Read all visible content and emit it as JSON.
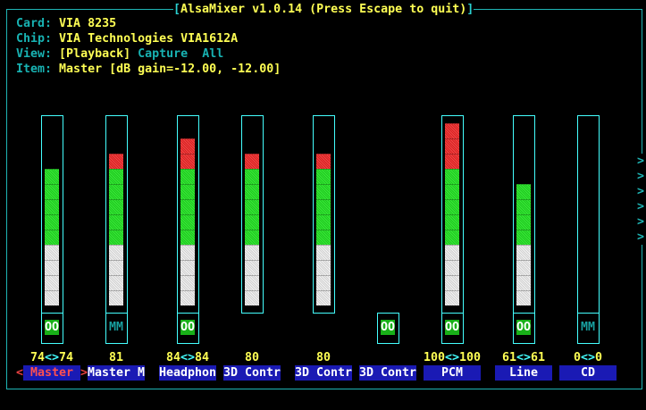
{
  "title": "AlsaMixer v1.0.14 (Press Escape to quit)",
  "info": {
    "card_label": "Card:",
    "card": "VIA 8235",
    "chip_label": "Chip:",
    "chip": "VIA Technologies VIA1612A",
    "view_label": "View:",
    "view_playback": "[Playback]",
    "view_capture": "Capture",
    "view_all": "All",
    "item_label": "Item:",
    "item": "Master [dB gain=-12.00, -12.00]"
  },
  "selected_left": "<",
  "selected_right": ">",
  "more_arrow": ">",
  "channels": [
    {
      "name": "Master",
      "volume": "74",
      "volume_r": "74",
      "stereo": true,
      "level": 74,
      "green": 5,
      "red": 0,
      "switch": "OO",
      "switch_on": true,
      "bar": true
    },
    {
      "name": "Master M",
      "volume": "81",
      "stereo": false,
      "level": 81,
      "green": 5,
      "red": 1,
      "switch": "MM",
      "switch_on": false,
      "bar": true
    },
    {
      "name": "Headphon",
      "volume": "84",
      "volume_r": "84",
      "stereo": true,
      "level": 84,
      "green": 5,
      "red": 2,
      "switch": "OO",
      "switch_on": true,
      "bar": true
    },
    {
      "name": "3D Contr",
      "volume": "80",
      "stereo": false,
      "level": 80,
      "green": 5,
      "red": 1,
      "switch": null,
      "bar": true
    },
    {
      "name": "3D Contr",
      "volume": "80",
      "stereo": false,
      "level": 80,
      "green": 5,
      "red": 1,
      "switch": null,
      "bar": true
    },
    {
      "name": "3D Contr",
      "volume": null,
      "stereo": false,
      "switch": "OO",
      "switch_on": true,
      "bar": false
    },
    {
      "name": "PCM",
      "volume": "100",
      "volume_r": "100",
      "stereo": true,
      "level": 100,
      "green": 5,
      "red": 3,
      "switch": "OO",
      "switch_on": true,
      "bar": true
    },
    {
      "name": "Line",
      "volume": "61",
      "volume_r": "61",
      "stereo": true,
      "level": 61,
      "green": 4,
      "red": 0,
      "switch": "OO",
      "switch_on": true,
      "bar": true
    },
    {
      "name": "CD",
      "volume": "0",
      "volume_r": "0",
      "stereo": true,
      "level": 0,
      "green": 0,
      "red": 0,
      "switch": "MM",
      "switch_on": false,
      "bar": true
    }
  ],
  "stereo_sep": "<>"
}
